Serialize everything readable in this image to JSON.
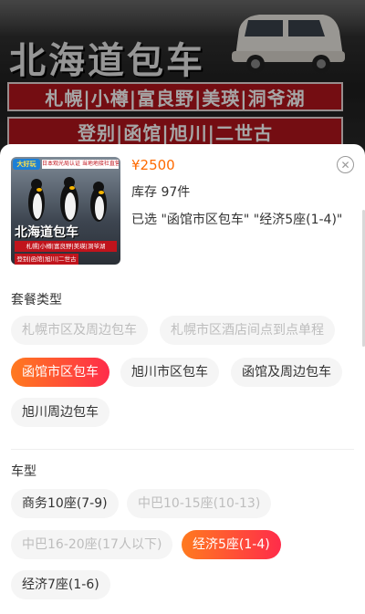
{
  "banner": {
    "title": "北海道包车",
    "line1": "札幌|小樽|富良野|美瑛|洞爷湖",
    "line2": "登别|函馆|旭川|二世古"
  },
  "product": {
    "price": "¥2500",
    "stock": "库存 97件",
    "selected": "已选 \"函馆市区包车\" \"经济5座(1-4)\"",
    "thumbnail": {
      "badge": "大好玩",
      "tag": "日本观光局认证 当地地接社直营",
      "title": "北海道包车",
      "row1": "札幌|小樽|富良野|美瑛|洞爷湖",
      "row2": "登别|函馆|旭川|二世古"
    }
  },
  "close_icon": "close-icon",
  "package": {
    "label": "套餐类型",
    "options": [
      {
        "label": "札幌市区及周边包车",
        "state": "disabled"
      },
      {
        "label": "札幌市区酒店间点到点单程",
        "state": "disabled"
      },
      {
        "label": "函馆市区包车",
        "state": "active"
      },
      {
        "label": "旭川市区包车",
        "state": "normal"
      },
      {
        "label": "函馆及周边包车",
        "state": "normal"
      },
      {
        "label": "旭川周边包车",
        "state": "normal"
      }
    ]
  },
  "vehicle": {
    "label": "车型",
    "options": [
      {
        "label": "商务10座(7-9)",
        "state": "normal"
      },
      {
        "label": "中巴10-15座(10-13)",
        "state": "disabled"
      },
      {
        "label": "中巴16-20座(17人以下)",
        "state": "disabled"
      },
      {
        "label": "经济5座(1-4)",
        "state": "active"
      },
      {
        "label": "经济7座(1-6)",
        "state": "normal"
      }
    ]
  },
  "colors": {
    "accent_start": "#ff7a1f",
    "accent_end": "#ff2c4a",
    "price": "#ff6a00",
    "banner_red": "#b3141c"
  }
}
